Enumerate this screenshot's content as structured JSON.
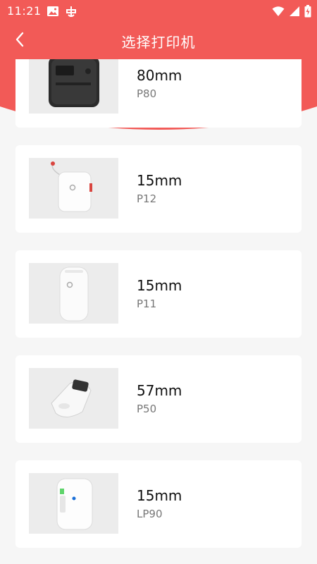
{
  "status_bar": {
    "time": "11:21",
    "left_icons": [
      "image-icon",
      "bug-icon"
    ],
    "right_icons": [
      "wifi-icon",
      "signal-icon",
      "battery-charging-icon"
    ]
  },
  "header": {
    "title": "选择打印机",
    "back_icon": "chevron-left-icon"
  },
  "colors": {
    "brand": "#f25a57",
    "background": "#f6f6f6",
    "card": "#ffffff"
  },
  "printers": [
    {
      "size": "80mm",
      "model": "P80"
    },
    {
      "size": "15mm",
      "model": "P12"
    },
    {
      "size": "15mm",
      "model": "P11"
    },
    {
      "size": "57mm",
      "model": "P50"
    },
    {
      "size": "15mm",
      "model": "LP90"
    }
  ]
}
